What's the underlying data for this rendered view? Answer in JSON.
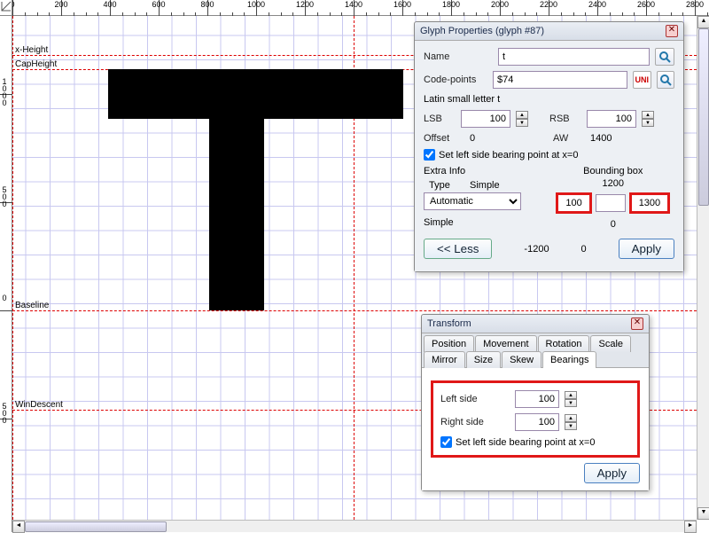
{
  "ruler_top_labels": [
    "0",
    "200",
    "400",
    "600",
    "800",
    "1000",
    "1200",
    "1400",
    "1600",
    "1800",
    "2000",
    "2200",
    "2400",
    "2600",
    "2800"
  ],
  "ruler_left_labels": [
    "1000",
    "500",
    "0",
    "500"
  ],
  "metrics": {
    "x_height": "x-Height",
    "cap_height": "CapHeight",
    "baseline": "Baseline",
    "win_descent": "WinDescent"
  },
  "glyph_props": {
    "title": "Glyph Properties (glyph #87)",
    "name_label": "Name",
    "name_value": "t",
    "code_label": "Code-points",
    "code_value": "$74",
    "desc": "Latin small letter t",
    "lsb_label": "LSB",
    "lsb_value": "100",
    "rsb_label": "RSB",
    "rsb_value": "100",
    "offset_label": "Offset",
    "offset_value": "0",
    "aw_label": "AW",
    "aw_value": "1400",
    "check_label": "Set left side bearing point at x=0",
    "extra_label": "Extra Info",
    "type_label": "Type",
    "type_val": "Simple",
    "auto": "Automatic",
    "simple": "Simple",
    "bbox_label": "Bounding box",
    "bbox_top": "1200",
    "bbox_left": "100",
    "bbox_right": "1300",
    "bbox_bottom": "0",
    "less": "<< Less",
    "m1": "-1200",
    "m2": "0",
    "apply": "Apply"
  },
  "transform": {
    "title": "Transform",
    "tabs": [
      "Position",
      "Movement",
      "Rotation",
      "Scale",
      "Mirror",
      "Size",
      "Skew",
      "Bearings"
    ],
    "active_tab": "Bearings",
    "left_label": "Left side",
    "left_value": "100",
    "right_label": "Right side",
    "right_value": "100",
    "check_label": "Set left side bearing point at x=0",
    "apply": "Apply"
  }
}
